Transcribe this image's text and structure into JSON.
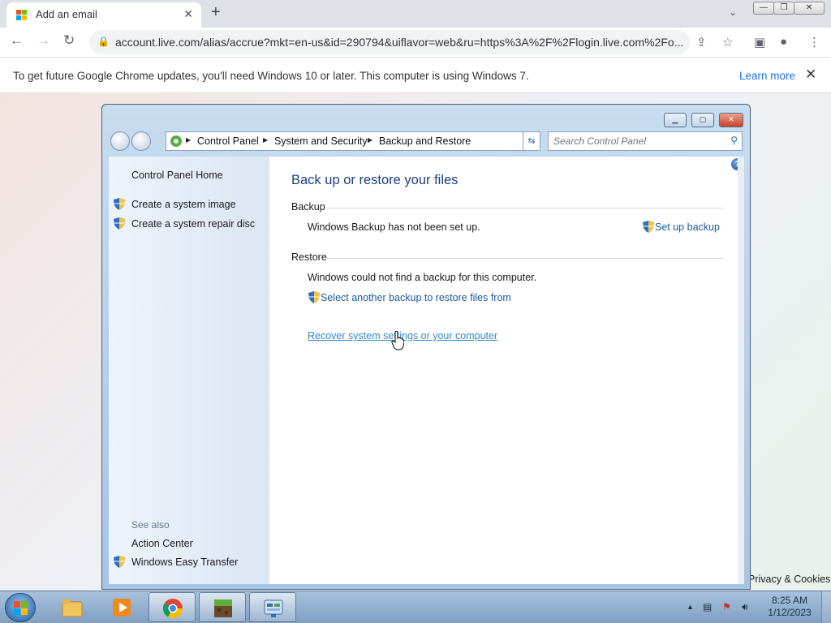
{
  "browser": {
    "tab_title": "Add an email",
    "url": "account.live.com/alias/accrue?mkt=en-us&id=290794&uiflavor=web&ru=https%3A%2F%2Flogin.live.com%2Fo...",
    "infobar_message": "To get future Google Chrome updates, you'll need Windows 10 or later. This computer is using Windows 7.",
    "infobar_link": "Learn more"
  },
  "control_panel": {
    "breadcrumb": [
      "Control Panel",
      "System and Security",
      "Backup and Restore"
    ],
    "search_placeholder": "Search Control Panel",
    "left_pane": {
      "home": "Control Panel Home",
      "tasks": [
        "Create a system image",
        "Create a system repair disc"
      ],
      "see_also_label": "See also",
      "see_also": [
        "Action Center",
        "Windows Easy Transfer"
      ]
    },
    "main": {
      "title": "Back up or restore your files",
      "backup_heading": "Backup",
      "backup_status": "Windows Backup has not been set up.",
      "setup_link": "Set up backup",
      "restore_heading": "Restore",
      "restore_status": "Windows could not find a backup for this computer.",
      "select_backup_link": "Select another backup to restore files from",
      "recover_link": "Recover system settings or your computer"
    }
  },
  "desktop": {
    "privacy_text": "Privacy & Cookies"
  },
  "taskbar": {
    "time": "8:25 AM",
    "date": "1/12/2023"
  },
  "icons": [
    "windows-logo-icon",
    "close-icon",
    "plus-icon",
    "back-arrow-icon",
    "forward-arrow-icon",
    "reload-icon",
    "lock-icon",
    "share-icon",
    "star-icon",
    "sidepanel-icon",
    "profile-icon",
    "more-icon",
    "uac-shield-icon",
    "help-icon",
    "search-icon",
    "folder-icon",
    "media-player-icon",
    "chrome-icon",
    "minecraft-icon",
    "control-panel-icon"
  ]
}
